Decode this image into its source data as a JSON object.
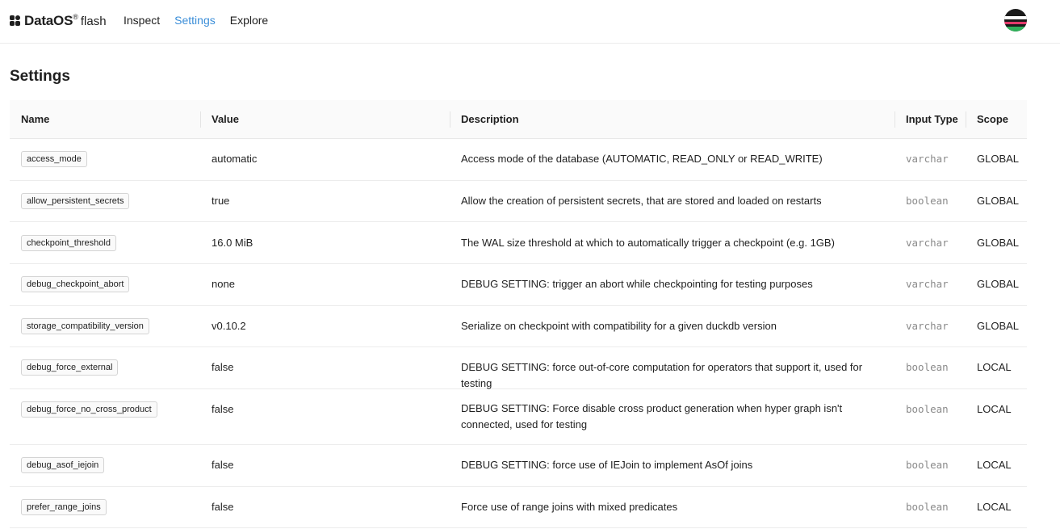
{
  "header": {
    "brand": "DataOS",
    "brand_sup": "®",
    "product": "flash",
    "nav": [
      {
        "label": "Inspect",
        "active": false
      },
      {
        "label": "Settings",
        "active": true
      },
      {
        "label": "Explore",
        "active": false
      }
    ],
    "accent_color": "#3b8ed8"
  },
  "page": {
    "title": "Settings"
  },
  "table": {
    "columns": [
      "Name",
      "Value",
      "Description",
      "Input Type",
      "Scope"
    ],
    "rows": [
      {
        "name": "access_mode",
        "value": "automatic",
        "description": "Access mode of the database (AUTOMATIC, READ_ONLY or READ_WRITE)",
        "input_type": "varchar",
        "scope": "GLOBAL"
      },
      {
        "name": "allow_persistent_secrets",
        "value": "true",
        "description": "Allow the creation of persistent secrets, that are stored and loaded on restarts",
        "input_type": "boolean",
        "scope": "GLOBAL"
      },
      {
        "name": "checkpoint_threshold",
        "value": "16.0 MiB",
        "description": "The WAL size threshold at which to automatically trigger a checkpoint (e.g. 1GB)",
        "input_type": "varchar",
        "scope": "GLOBAL"
      },
      {
        "name": "debug_checkpoint_abort",
        "value": "none",
        "description": "DEBUG SETTING: trigger an abort while checkpointing for testing purposes",
        "input_type": "varchar",
        "scope": "GLOBAL"
      },
      {
        "name": "storage_compatibility_version",
        "value": "v0.10.2",
        "description": "Serialize on checkpoint with compatibility for a given duckdb version",
        "input_type": "varchar",
        "scope": "GLOBAL"
      },
      {
        "name": "debug_force_external",
        "value": "false",
        "description": "DEBUG SETTING: force out-of-core computation for operators that support it, used for testing",
        "input_type": "boolean",
        "scope": "LOCAL"
      },
      {
        "name": "debug_force_no_cross_product",
        "value": "false",
        "description": "DEBUG SETTING: Force disable cross product generation when hyper graph isn't connected, used for testing",
        "input_type": "boolean",
        "scope": "LOCAL"
      },
      {
        "name": "debug_asof_iejoin",
        "value": "false",
        "description": "DEBUG SETTING: force use of IEJoin to implement AsOf joins",
        "input_type": "boolean",
        "scope": "LOCAL"
      },
      {
        "name": "prefer_range_joins",
        "value": "false",
        "description": "Force use of range joins with mixed predicates",
        "input_type": "boolean",
        "scope": "LOCAL"
      }
    ]
  }
}
